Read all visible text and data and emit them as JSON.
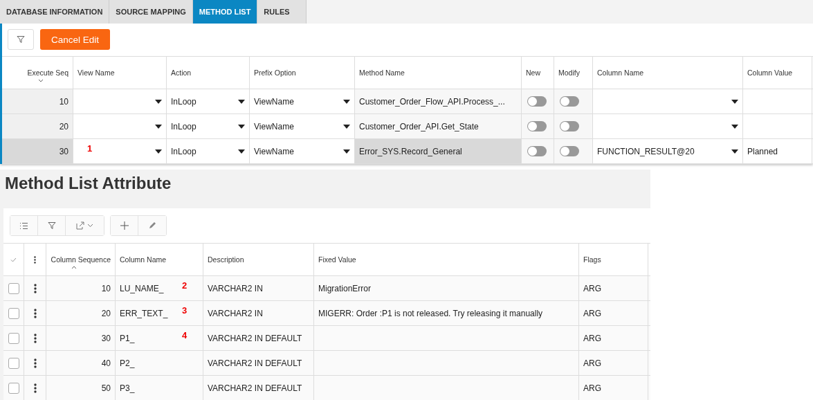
{
  "tabs": [
    {
      "label": "DATABASE INFORMATION",
      "selected": false
    },
    {
      "label": "SOURCE MAPPING",
      "selected": false
    },
    {
      "label": "METHOD LIST",
      "selected": true
    },
    {
      "label": "RULES",
      "selected": false
    }
  ],
  "toolbar": {
    "cancel_button": "Cancel Edit"
  },
  "method_table": {
    "columns": [
      "Execute Seq",
      "View Name",
      "Action",
      "Prefix Option",
      "Method Name",
      "New",
      "Modify",
      "Column Name",
      "Column Value"
    ],
    "rows": [
      {
        "execute_seq": "10",
        "view_name": "",
        "annotation": "",
        "action": "InLoop",
        "prefix_option": "ViewName",
        "method_name": "Customer_Order_Flow_API.Process_...",
        "new": false,
        "modify": false,
        "column_name": "",
        "column_value": "",
        "selected": false
      },
      {
        "execute_seq": "20",
        "view_name": "",
        "annotation": "",
        "action": "InLoop",
        "prefix_option": "ViewName",
        "method_name": "Customer_Order_API.Get_State",
        "new": false,
        "modify": false,
        "column_name": "",
        "column_value": "",
        "selected": false
      },
      {
        "execute_seq": "30",
        "view_name": "",
        "annotation": "1",
        "action": "InLoop",
        "prefix_option": "ViewName",
        "method_name": "Error_SYS.Record_General",
        "new": false,
        "modify": false,
        "column_name": "FUNCTION_RESULT@20",
        "column_value": "Planned",
        "selected": true
      }
    ]
  },
  "attribute_section": {
    "title": "Method List Attribute",
    "columns": [
      "Column Sequence",
      "Column Name",
      "Description",
      "Fixed Value",
      "Flags"
    ],
    "rows": [
      {
        "checked": false,
        "column_sequence": "10",
        "column_name": "LU_NAME_",
        "annotation": "2",
        "description": "VARCHAR2 IN",
        "fixed_value": "MigrationError",
        "flags": "ARG"
      },
      {
        "checked": false,
        "column_sequence": "20",
        "column_name": "ERR_TEXT_",
        "annotation": "3",
        "description": "VARCHAR2 IN",
        "fixed_value": "MIGERR: Order :P1 is not released. Try releasing it manually",
        "flags": "ARG"
      },
      {
        "checked": false,
        "column_sequence": "30",
        "column_name": "P1_",
        "annotation": "4",
        "description": "VARCHAR2 IN DEFAULT",
        "fixed_value": "",
        "flags": "ARG"
      },
      {
        "checked": false,
        "column_sequence": "40",
        "column_name": "P2_",
        "annotation": "",
        "description": "VARCHAR2 IN DEFAULT",
        "fixed_value": "",
        "flags": "ARG"
      },
      {
        "checked": false,
        "column_sequence": "50",
        "column_name": "P3_",
        "annotation": "",
        "description": "VARCHAR2 IN DEFAULT",
        "fixed_value": "",
        "flags": "ARG"
      }
    ]
  }
}
